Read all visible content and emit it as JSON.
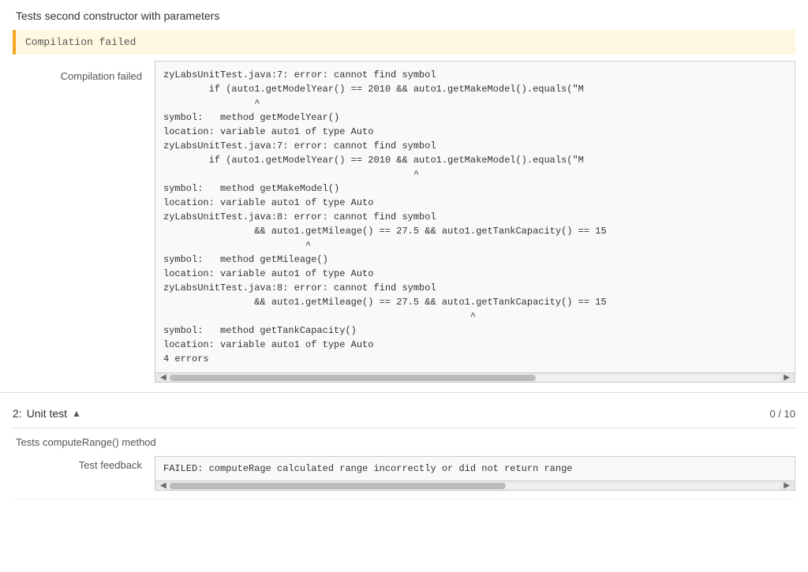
{
  "section1": {
    "title": "Tests second constructor with parameters",
    "banner": "Compilation failed",
    "error_label": "Compilation failed",
    "error_code": "zyLabsUnitTest.java:7: error: cannot find symbol\n        if (auto1.getModelYear() == 2010 && auto1.getMakeModel().equals(\"M\n                ^\nsymbol:   method getModelYear()\nlocation: variable auto1 of type Auto\nzyLabsUnitTest.java:7: error: cannot find symbol\n        if (auto1.getModelYear() == 2010 && auto1.getMakeModel().equals(\"M\n                                            ^\nsymbol:   method getMakeModel()\nlocation: variable auto1 of type Auto\nzyLabsUnitTest.java:8: error: cannot find symbol\n                && auto1.getMileage() == 27.5 && auto1.getTankCapacity() == 15\n                         ^\nsymbol:   method getMileage()\nlocation: variable auto1 of type Auto\nzyLabsUnitTest.java:8: error: cannot find symbol\n                && auto1.getMileage() == 27.5 && auto1.getTankCapacity() == 15\n                                                      ^\nsymbol:   method getTankCapacity()\nlocation: variable auto1 of type Auto\n4 errors"
  },
  "section2": {
    "header_number": "2:",
    "header_label": "Unit test",
    "chevron": "▲",
    "score": "0 / 10",
    "test_item_title": "Tests computeRange() method",
    "feedback_label": "Test feedback",
    "feedback_text": "FAILED: computeRage calculated range incorrectly or did not return range"
  }
}
